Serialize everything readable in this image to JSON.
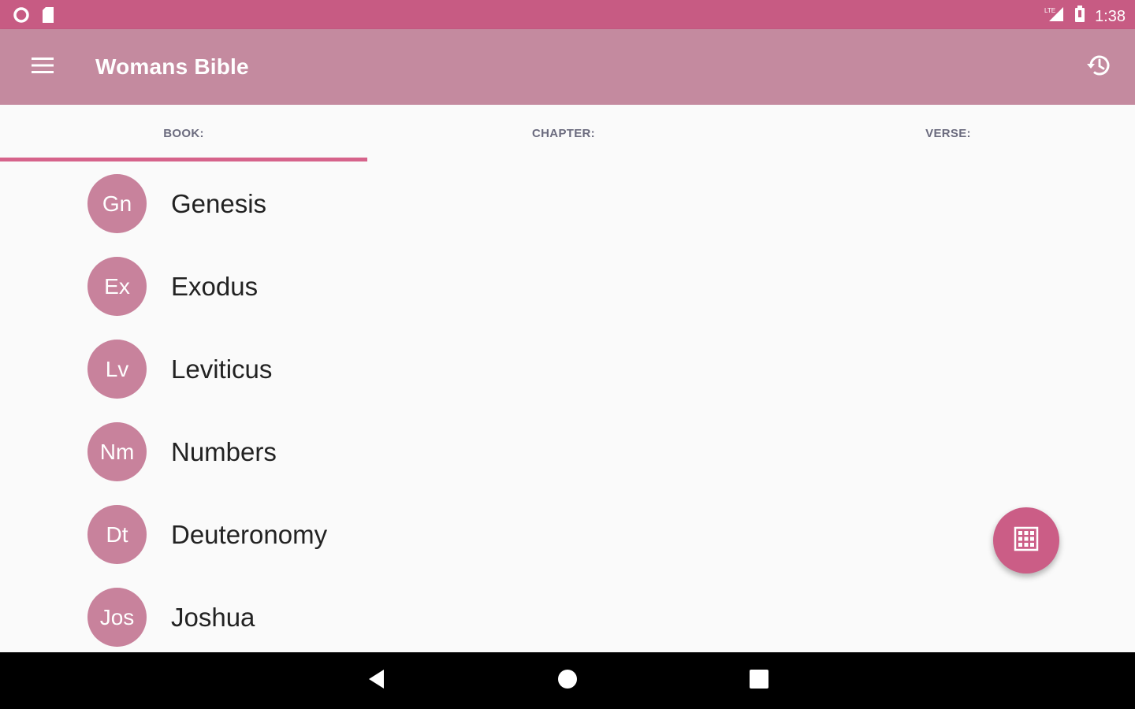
{
  "status_bar": {
    "time": "1:38",
    "left_icons": [
      "circle-notification-icon",
      "sd-card-icon"
    ],
    "right_icons": [
      "signal-icon",
      "battery-icon"
    ]
  },
  "app_bar": {
    "title": "Womans Bible",
    "menu_icon": "menu-icon",
    "history_icon": "history-icon"
  },
  "tabs": [
    {
      "label": "BOOK:",
      "selected": true
    },
    {
      "label": "CHAPTER:",
      "selected": false
    },
    {
      "label": "VERSE:",
      "selected": false
    }
  ],
  "books": [
    {
      "abbr": "Gn",
      "name": "Genesis"
    },
    {
      "abbr": "Ex",
      "name": "Exodus"
    },
    {
      "abbr": "Lv",
      "name": "Leviticus"
    },
    {
      "abbr": "Nm",
      "name": "Numbers"
    },
    {
      "abbr": "Dt",
      "name": "Deuteronomy"
    },
    {
      "abbr": "Jos",
      "name": "Joshua"
    }
  ],
  "fab": {
    "icon": "grid-icon"
  },
  "colors": {
    "status_bar": "#c75b83",
    "app_bar": "#c48a9f",
    "accent": "#d6638b",
    "avatar": "#c8829c",
    "fab": "#cb5d86"
  }
}
